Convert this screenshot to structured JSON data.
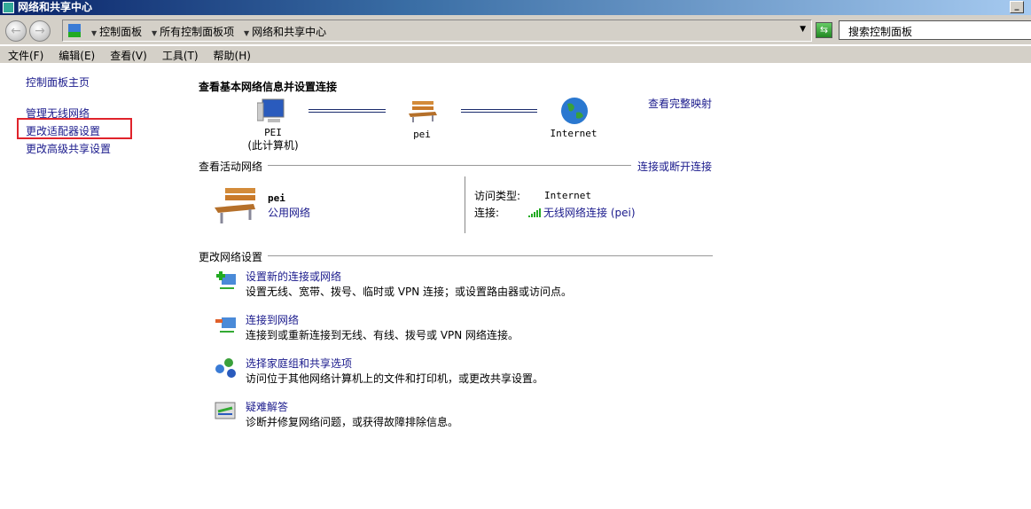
{
  "window": {
    "title": "网络和共享中心"
  },
  "address": {
    "crumbs": [
      "控制面板",
      "所有控制面板项",
      "网络和共享中心"
    ],
    "search_placeholder": "搜索控制面板"
  },
  "menu": [
    "文件(F)",
    "编辑(E)",
    "查看(V)",
    "工具(T)",
    "帮助(H)"
  ],
  "sidebar": {
    "items": [
      "控制面板主页",
      "管理无线网络",
      "更改适配器设置",
      "更改高级共享设置"
    ],
    "highlighted": "更改适配器设置"
  },
  "main": {
    "title": "查看基本网络信息并设置连接",
    "full_map_link": "查看完整映射",
    "map": {
      "computer": "PEI",
      "computer_sub": "(此计算机)",
      "network": "pei",
      "internet": "Internet"
    },
    "active_header": "查看活动网络",
    "connect_link": "连接或断开连接",
    "active": {
      "name": "pei",
      "type": "公用网络",
      "access_label": "访问类型:",
      "access_value": "Internet",
      "conn_label": "连接:",
      "conn_value": "无线网络连接 (pei)"
    },
    "change_header": "更改网络设置",
    "tasks": [
      {
        "title": "设置新的连接或网络",
        "desc": "设置无线、宽带、拨号、临时或 VPN 连接；或设置路由器或访问点。"
      },
      {
        "title": "连接到网络",
        "desc": "连接到或重新连接到无线、有线、拨号或 VPN 网络连接。"
      },
      {
        "title": "选择家庭组和共享选项",
        "desc": "访问位于其他网络计算机上的文件和打印机，或更改共享设置。"
      },
      {
        "title": "疑难解答",
        "desc": "诊断并修复网络问题，或获得故障排除信息。"
      }
    ]
  },
  "colors": {
    "link": "#1a1a8c",
    "highlight_box": "#e0232b"
  }
}
